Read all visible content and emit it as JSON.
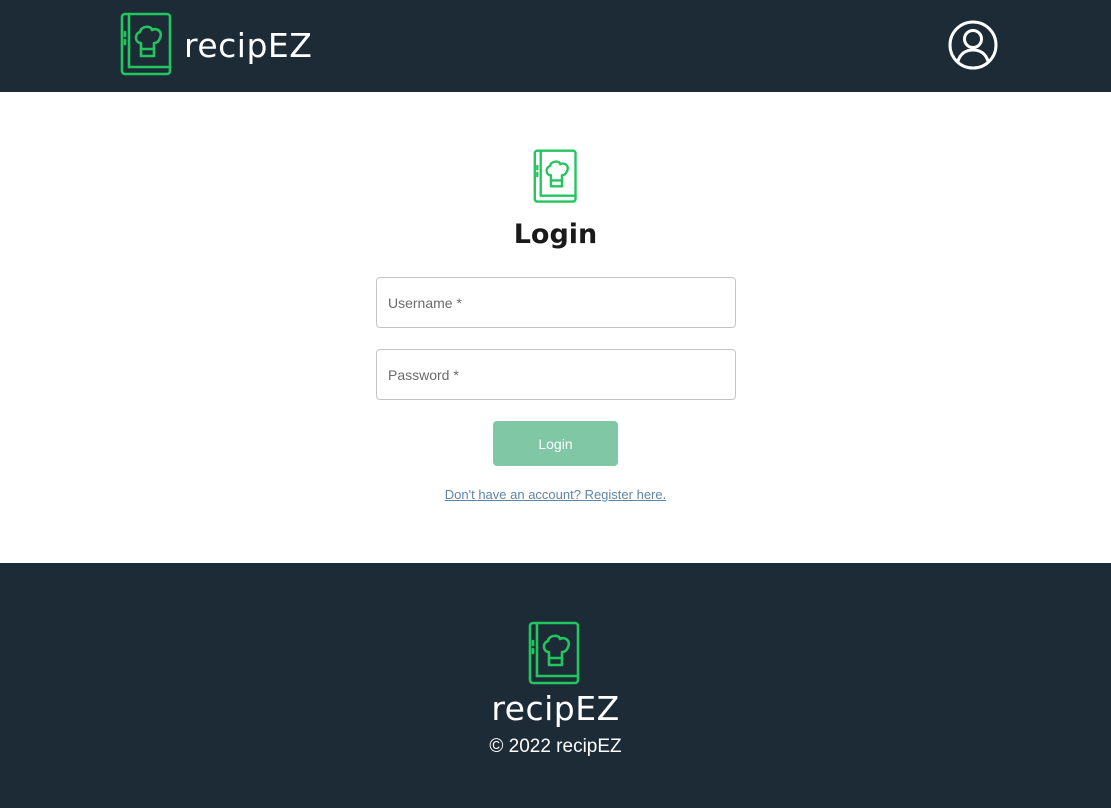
{
  "header": {
    "brand_name": "recipEZ",
    "logo_icon": "chef-hat-book-icon",
    "profile_icon": "user-circle-icon"
  },
  "login": {
    "logo_icon": "chef-hat-book-icon",
    "title": "Login",
    "username": {
      "placeholder": "Username *",
      "value": ""
    },
    "password": {
      "placeholder": "Password *",
      "value": ""
    },
    "submit_label": "Login",
    "register_link": "Don't have an account? Register here."
  },
  "footer": {
    "logo_icon": "chef-hat-book-icon",
    "brand_name": "recipEZ",
    "copyright": "© 2022 recipEZ"
  },
  "colors": {
    "dark_navy": "#1c2b36",
    "brand_green": "#22c55e",
    "button_green": "#80c7a6",
    "link_blue": "#5f86a8"
  }
}
